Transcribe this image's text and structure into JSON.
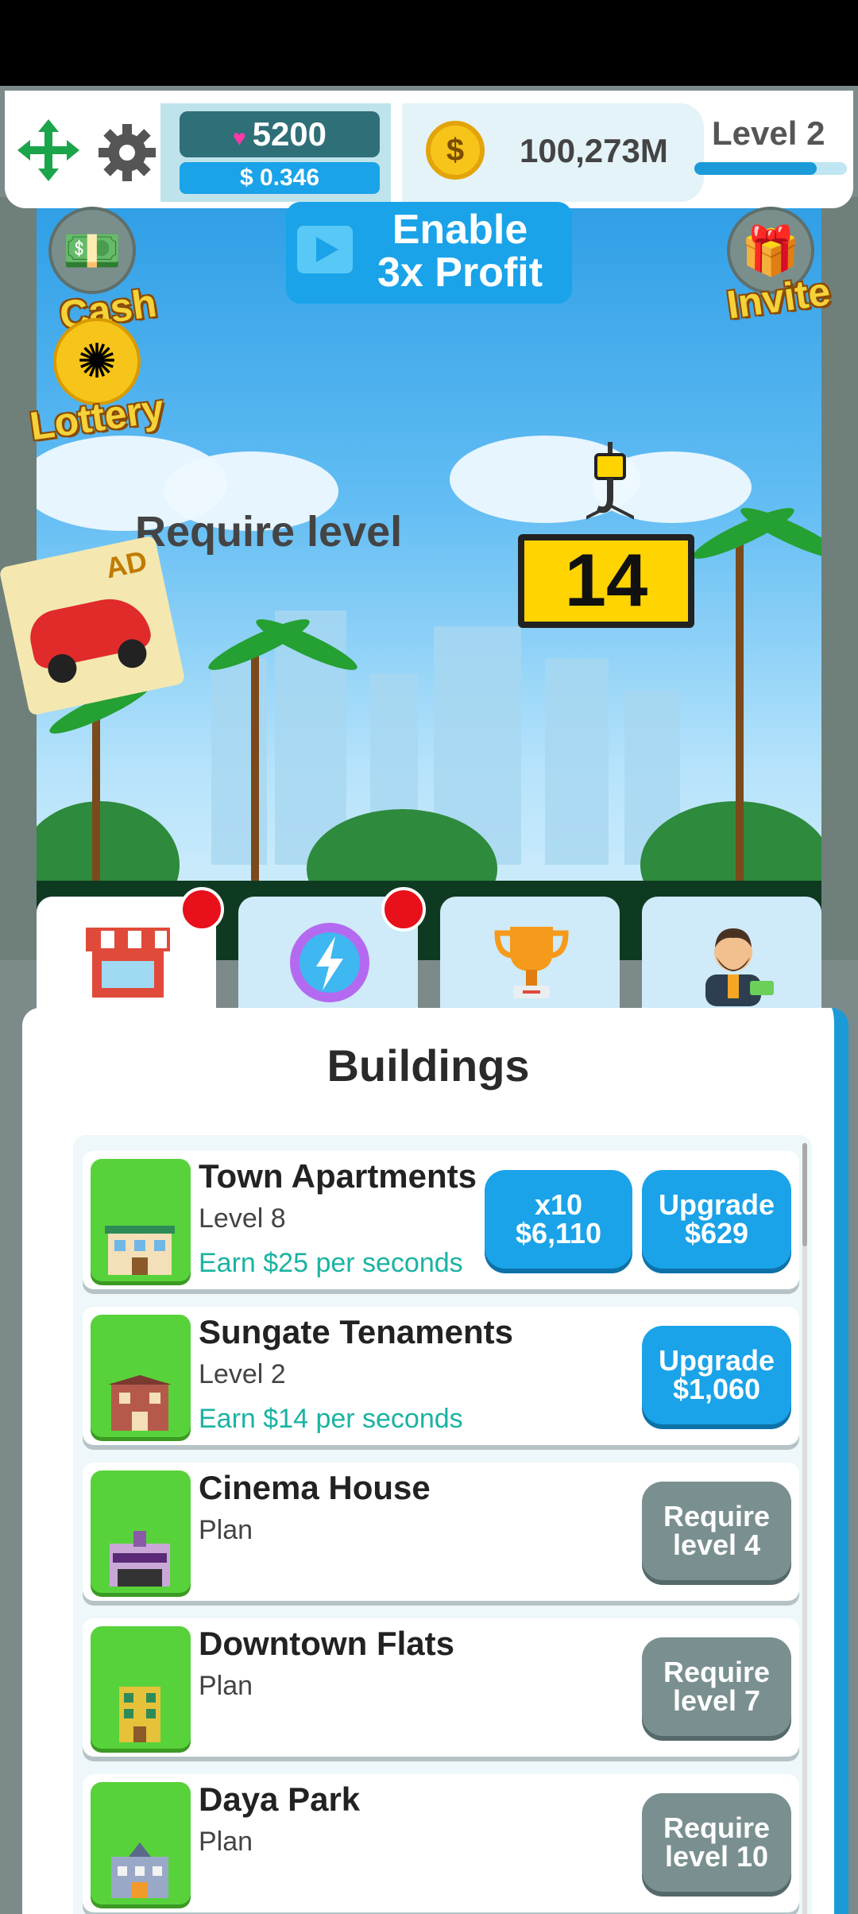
{
  "header": {
    "gems": "5200",
    "usd": "$ 0.346",
    "coin_symbol": "$",
    "coins": "100,273M",
    "level": "Level 2",
    "level_progress": 0.8
  },
  "side_buttons": {
    "cash": "Cash",
    "lottery": "Lottery",
    "invite": "Invite"
  },
  "enable_button": {
    "line1": "Enable",
    "line2": "3x Profit"
  },
  "scene": {
    "require_text": "Require level",
    "require_level": "14",
    "ad_badge": "AD"
  },
  "tabs": [
    {
      "name": "shop",
      "icon": "shop-icon",
      "active": true,
      "notification": true
    },
    {
      "name": "boost",
      "icon": "lightning-icon",
      "active": false,
      "notification": true
    },
    {
      "name": "trophy",
      "icon": "trophy-icon",
      "active": false,
      "notification": false
    },
    {
      "name": "manager",
      "icon": "manager-icon",
      "active": false,
      "notification": false
    }
  ],
  "panel": {
    "title": "Buildings",
    "buildings": [
      {
        "name": "Town Apartments",
        "level": "Level 8",
        "earn": "Earn $25 per seconds",
        "x10_line1": "x10",
        "x10_line2": "$6,110",
        "btn_line1": "Upgrade",
        "btn_line2": "$629",
        "btn_color": "blue"
      },
      {
        "name": "Sungate Tenaments",
        "level": "Level 2",
        "earn": "Earn $14 per seconds",
        "btn_line1": "Upgrade",
        "btn_line2": "$1,060",
        "btn_color": "blue"
      },
      {
        "name": "Cinema House",
        "level": "Plan",
        "earn": "",
        "btn_line1": "Require",
        "btn_line2": "level 4",
        "btn_color": "gray"
      },
      {
        "name": "Downtown Flats",
        "level": "Plan",
        "earn": "",
        "btn_line1": "Require",
        "btn_line2": "level 7",
        "btn_color": "gray"
      },
      {
        "name": "Daya Park",
        "level": "Plan",
        "earn": "",
        "btn_line1": "Require",
        "btn_line2": "level 10",
        "btn_color": "gray"
      }
    ]
  },
  "colors": {
    "accent_blue": "#1aa3e8",
    "earn_teal": "#1ab3a2",
    "gray_button": "#7a8f90",
    "thumb_green": "#58d23a",
    "notification_red": "#e8101a"
  }
}
